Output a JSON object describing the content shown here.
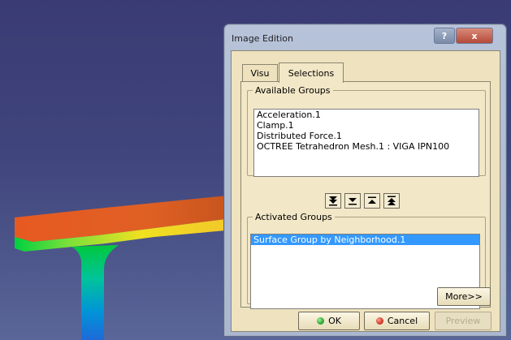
{
  "dialog": {
    "title": "Image Edition",
    "help_label": "?",
    "close_label": "x",
    "tabs": [
      {
        "label": "Visu",
        "active": false
      },
      {
        "label": "Selections",
        "active": true
      }
    ],
    "available_groups": {
      "label": "Available Groups",
      "items": [
        "Acceleration.1",
        "Clamp.1",
        "Distributed Force.1",
        "OCTREE Tetrahedron Mesh.1 : VIGA IPN100"
      ]
    },
    "transfer_buttons": [
      {
        "icon": "move-all-down-icon"
      },
      {
        "icon": "move-down-icon"
      },
      {
        "icon": "move-up-icon"
      },
      {
        "icon": "move-all-up-icon"
      }
    ],
    "activated_groups": {
      "label": "Activated Groups",
      "items": [
        {
          "label": "Surface Group by Neighborhood.1",
          "selected": true
        }
      ]
    },
    "buttons": {
      "more": "More>>",
      "ok": "OK",
      "cancel": "Cancel",
      "preview": "Preview"
    },
    "colors": {
      "selection": "#3399ff",
      "ok_icon": "#2fa52f",
      "cancel_icon": "#d43a2a",
      "panel": "#efe3bf"
    }
  }
}
